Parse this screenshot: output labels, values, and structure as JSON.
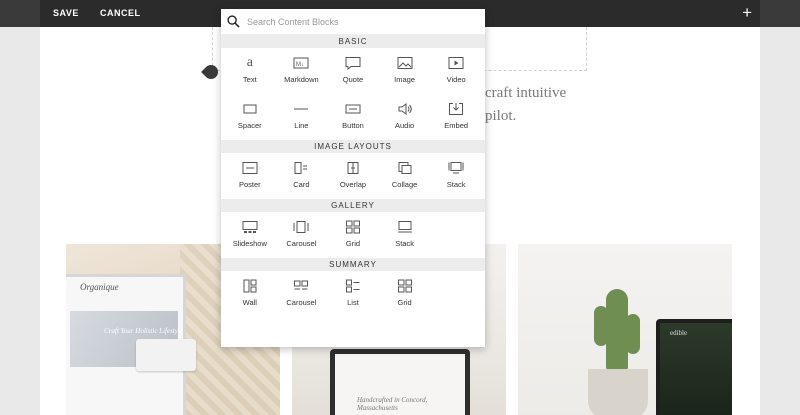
{
  "toolbar": {
    "save_label": "SAVE",
    "cancel_label": "CANCEL",
    "add_label": "+"
  },
  "page": {
    "text_line_1": "craft intuitive",
    "text_line_2": "pilot."
  },
  "photos": {
    "tablet_brand": "Organique",
    "tablet_tagline": "Craft Your Holistic Lifestyle",
    "laptop_text": "Handcrafted in Concord, Massachusetts",
    "monitor_brand": "edible"
  },
  "search": {
    "placeholder": "Search Content Blocks"
  },
  "sections": [
    {
      "title": "BASIC",
      "items": [
        {
          "label": "Text",
          "icon": "text-icon"
        },
        {
          "label": "Markdown",
          "icon": "markdown-icon"
        },
        {
          "label": "Quote",
          "icon": "quote-icon"
        },
        {
          "label": "Image",
          "icon": "image-icon"
        },
        {
          "label": "Video",
          "icon": "video-icon"
        },
        {
          "label": "Spacer",
          "icon": "spacer-icon"
        },
        {
          "label": "Line",
          "icon": "line-icon"
        },
        {
          "label": "Button",
          "icon": "button-icon"
        },
        {
          "label": "Audio",
          "icon": "audio-icon"
        },
        {
          "label": "Embed",
          "icon": "embed-icon"
        }
      ]
    },
    {
      "title": "IMAGE LAYOUTS",
      "items": [
        {
          "label": "Poster",
          "icon": "poster-icon"
        },
        {
          "label": "Card",
          "icon": "card-icon"
        },
        {
          "label": "Overlap",
          "icon": "overlap-icon"
        },
        {
          "label": "Collage",
          "icon": "collage-icon"
        },
        {
          "label": "Stack",
          "icon": "stack-icon"
        }
      ]
    },
    {
      "title": "GALLERY",
      "items": [
        {
          "label": "Slideshow",
          "icon": "slideshow-icon"
        },
        {
          "label": "Carousel",
          "icon": "carousel-icon"
        },
        {
          "label": "Grid",
          "icon": "grid-icon"
        },
        {
          "label": "Stack",
          "icon": "gallery-stack-icon"
        }
      ]
    },
    {
      "title": "SUMMARY",
      "items": [
        {
          "label": "Wall",
          "icon": "wall-icon"
        },
        {
          "label": "Carousel",
          "icon": "summary-carousel-icon"
        },
        {
          "label": "List",
          "icon": "list-icon"
        },
        {
          "label": "Grid",
          "icon": "summary-grid-icon"
        }
      ]
    }
  ],
  "colors": {
    "toolbar_bg": "#2b2b2b",
    "section_bg": "#ececec",
    "icon_stroke": "#555555"
  }
}
